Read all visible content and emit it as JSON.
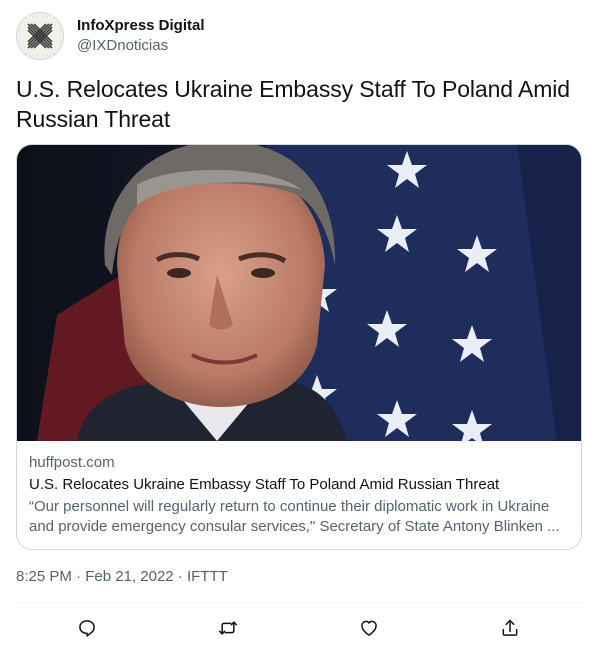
{
  "author": {
    "display_name": "InfoXpress Digital",
    "handle": "@IXDnoticias",
    "avatar_icon": "x-logo-avatar-icon"
  },
  "tweet": {
    "text": "U.S. Relocates Ukraine Embassy Staff To Poland Amid Russian Threat",
    "time": "8:25 PM",
    "date": "Feb 21, 2022",
    "source": "IFTTT"
  },
  "card": {
    "domain": "huffpost.com",
    "title": "U.S. Relocates Ukraine Embassy Staff To Poland Amid Russian Threat",
    "description": "“Our personnel will regularly return to continue their diplomatic work in Ukraine\nand provide emergency consular services,\" Secretary of State Antony Blinken ..."
  },
  "actions": [
    {
      "name": "reply",
      "icon": "reply-icon"
    },
    {
      "name": "retweet",
      "icon": "retweet-icon"
    },
    {
      "name": "like",
      "icon": "heart-icon"
    },
    {
      "name": "share",
      "icon": "share-icon"
    }
  ],
  "colors": {
    "text_primary": "#0f1419",
    "text_secondary": "#536471",
    "border": "#cfd9de",
    "flag_blue": "#1f2d5c",
    "flag_red": "#9c2431"
  }
}
